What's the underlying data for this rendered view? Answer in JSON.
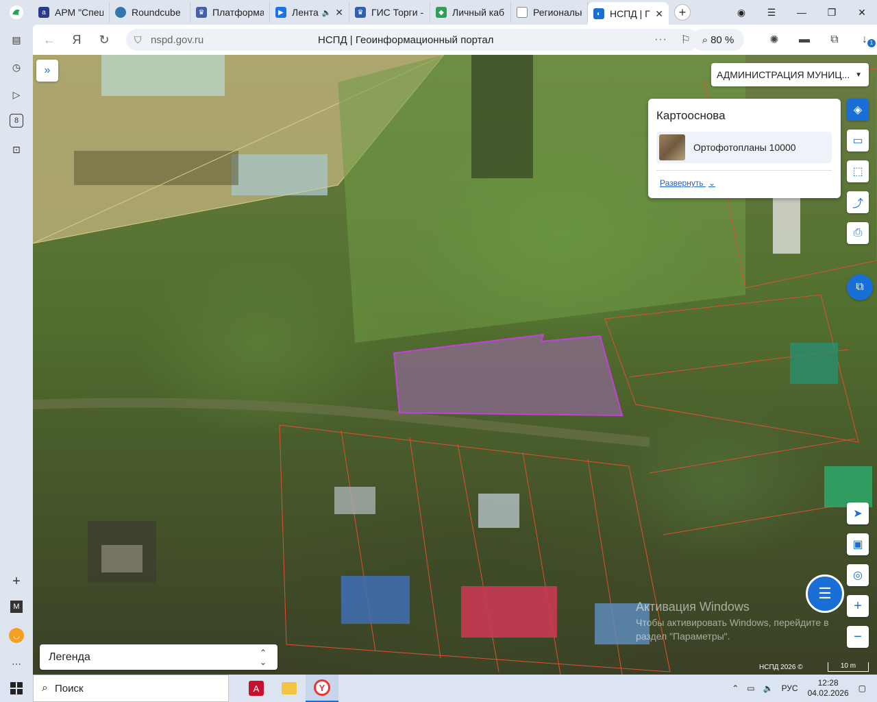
{
  "browser": {
    "tabs": [
      {
        "title": "АРМ \"Спец",
        "color": "#2d3a8c"
      },
      {
        "title": "Roundcube",
        "color": "#37a"
      },
      {
        "title": "Платформа",
        "color": "#4660a8"
      },
      {
        "title": "Лента",
        "color": "#1a73e8"
      },
      {
        "title": "ГИС Торги -",
        "color": "#3060b0"
      },
      {
        "title": "Личный каб",
        "color": "#2f9e5b"
      },
      {
        "title": "Региональн",
        "color": "#888"
      },
      {
        "title": "НСПД | Г",
        "color": "#1a6fd6"
      }
    ],
    "domain": "nspd.gov.ru",
    "page_title": "НСПД | Геоинформационный портал",
    "zoom": "80 %",
    "more_dots": "···",
    "download_badge": "1"
  },
  "map": {
    "municipality_dropdown": "АДМИНИСТРАЦИЯ МУНИЦ...",
    "basemap_panel": {
      "title": "Картооснова",
      "item": "Ортофотопланы 10000",
      "expand": "Развернуть"
    },
    "legend": "Легенда",
    "activation": {
      "line1": "Активация Windows",
      "line2": "Чтобы активировать Windows, перейдите в",
      "line3": "раздел \"Параметры\"."
    },
    "attribution": "НСПД 2026 ©",
    "scale": "10 m"
  },
  "taskbar": {
    "search": "Поиск",
    "lang": "РУС",
    "time": "12:28",
    "date": "04.02.2026"
  },
  "sidebar": {
    "counter": "8"
  }
}
